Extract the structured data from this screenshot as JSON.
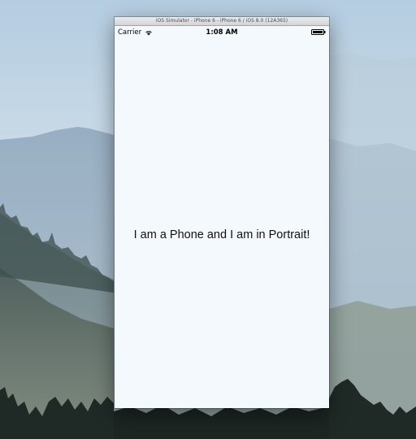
{
  "window": {
    "title": "iOS Simulator - iPhone 6 - iPhone 6 / iOS 8.0 (12A365)"
  },
  "status_bar": {
    "carrier": "Carrier",
    "time": "1:08 AM"
  },
  "screen": {
    "label": "I am a Phone and I am in Portrait!"
  },
  "colors": {
    "screen_background": "#f4f9fe",
    "title_bar": "#d8d8d8"
  }
}
